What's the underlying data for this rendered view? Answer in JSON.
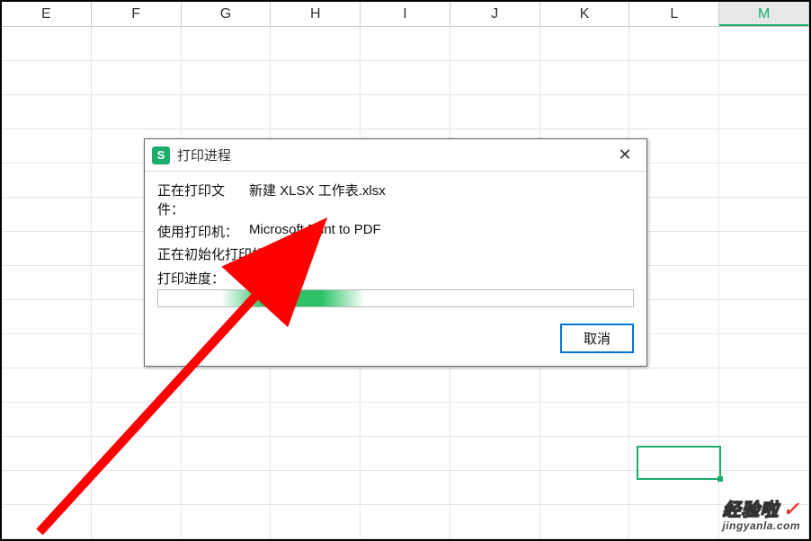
{
  "columns": [
    "E",
    "F",
    "G",
    "H",
    "I",
    "J",
    "K",
    "L",
    "M"
  ],
  "activeColumn": "M",
  "dialog": {
    "title": "打印进程",
    "file_label": "正在打印文件：",
    "file_value": "新建 XLSX 工作表.xlsx",
    "printer_label": "使用打印机：",
    "printer_value": "Microsoft Print to PDF",
    "status": "正在初始化打印机...",
    "progress_label": "打印进度：",
    "cancel": "取消"
  },
  "watermark": {
    "main": "经验啦",
    "sub": "jingyanla.com"
  }
}
